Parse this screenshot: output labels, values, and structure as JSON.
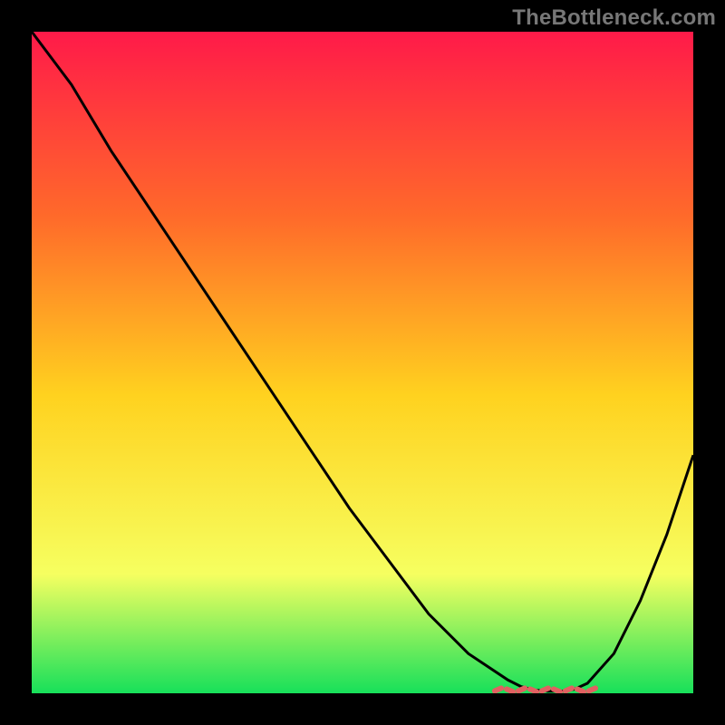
{
  "branding": {
    "watermark": "TheBottleneck.com"
  },
  "colors": {
    "background": "#000000",
    "gradient_top": "#ff1a49",
    "gradient_mid_upper": "#ff6a2a",
    "gradient_mid": "#ffd21f",
    "gradient_lower": "#f6ff60",
    "gradient_bottom": "#17e05a",
    "curve": "#000000",
    "highlight": "#e16161"
  },
  "chart_data": {
    "type": "line",
    "title": "",
    "xlabel": "",
    "ylabel": "",
    "xlim": [
      0,
      100
    ],
    "ylim": [
      0,
      100
    ],
    "grid": false,
    "legend": false,
    "series": [
      {
        "name": "bottleneck-curve",
        "x": [
          0,
          6,
          12,
          18,
          24,
          30,
          36,
          42,
          48,
          54,
          60,
          66,
          72,
          74,
          76,
          78,
          80,
          82,
          84,
          88,
          92,
          96,
          100
        ],
        "y": [
          100,
          92,
          82,
          73,
          64,
          55,
          46,
          37,
          28,
          20,
          12,
          6,
          2,
          1,
          0.5,
          0.3,
          0.3,
          0.6,
          1.5,
          6,
          14,
          24,
          36
        ]
      }
    ],
    "highlight_region": {
      "description": "flat-bottom optimum band highlighted with tick marks",
      "x_start": 70,
      "x_end": 86,
      "y": 0.5
    }
  }
}
